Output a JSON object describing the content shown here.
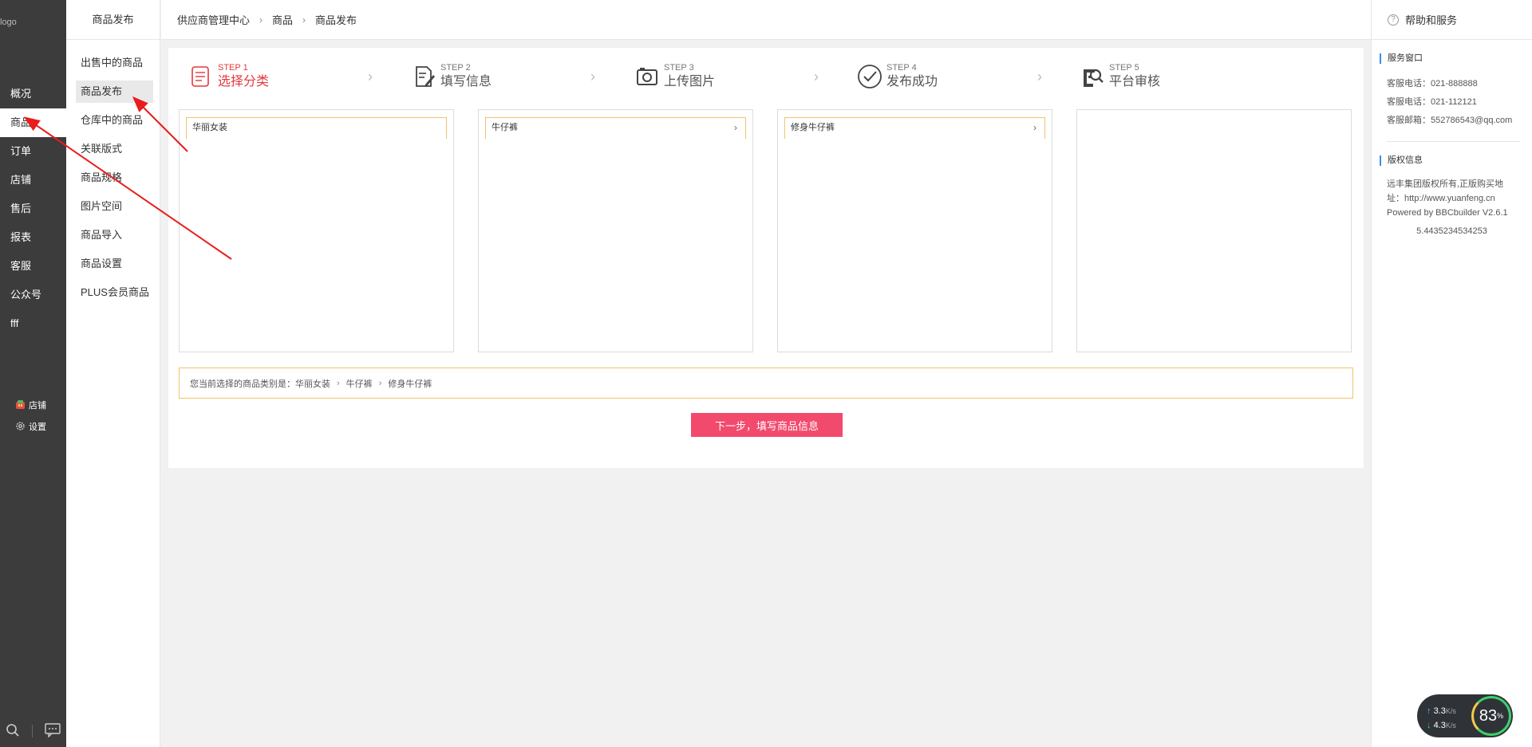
{
  "logo_alt": "logo",
  "nav": {
    "items": [
      {
        "label": "概况"
      },
      {
        "label": "商品",
        "active": true
      },
      {
        "label": "订单"
      },
      {
        "label": "店铺"
      },
      {
        "label": "售后"
      },
      {
        "label": "报表"
      },
      {
        "label": "客服"
      },
      {
        "label": "公众号"
      },
      {
        "label": "fff"
      }
    ],
    "tools": [
      {
        "label": "店铺",
        "icon": "shop-icon"
      },
      {
        "label": "设置",
        "icon": "gear-icon"
      }
    ],
    "bottom_icons": [
      "search-icon",
      "chat-icon"
    ]
  },
  "subnav": {
    "title": "商品发布",
    "items": [
      {
        "label": "出售中的商品"
      },
      {
        "label": "商品发布",
        "active": true
      },
      {
        "label": "仓库中的商品"
      },
      {
        "label": "关联版式"
      },
      {
        "label": "商品规格"
      },
      {
        "label": "图片空间"
      },
      {
        "label": "商品导入"
      },
      {
        "label": "商品设置"
      },
      {
        "label": "PLUS会员商品"
      }
    ]
  },
  "breadcrumb": [
    "供应商管理中心",
    "商品",
    "商品发布"
  ],
  "steps": [
    {
      "num": "STEP 1",
      "label": "选择分类",
      "icon": "list-icon",
      "active": true
    },
    {
      "num": "STEP 2",
      "label": "填写信息",
      "icon": "edit-icon"
    },
    {
      "num": "STEP 3",
      "label": "上传图片",
      "icon": "camera-icon"
    },
    {
      "num": "STEP 4",
      "label": "发布成功",
      "icon": "check-circle-icon"
    },
    {
      "num": "STEP 5",
      "label": "平台审核",
      "icon": "search-doc-icon"
    }
  ],
  "category_columns": [
    {
      "option": "华丽女装",
      "has_arrow": false
    },
    {
      "option": "牛仔裤",
      "has_arrow": true
    },
    {
      "option": "修身牛仔裤",
      "has_arrow": true
    },
    {
      "option": "",
      "has_arrow": false
    }
  ],
  "selected": {
    "prefix": "您当前选择的商品类别是：",
    "path": [
      "华丽女装",
      "牛仔裤",
      "修身牛仔裤"
    ]
  },
  "next_button": "下一步，填写商品信息",
  "help": {
    "title": "帮助和服务",
    "service_title": "服务窗口",
    "service_lines": [
      "客服电话：021-888888",
      "客服电话：021-112121",
      "客服邮箱：552786543@qq.com"
    ],
    "copyright_title": "版权信息",
    "copyright_text": "远丰集团版权所有,正版购买地址：http://www.yuanfeng.cn Powered by BBCbuilder V2.6.1",
    "version": "5.4435234534253"
  },
  "speed_widget": {
    "up": "3.3",
    "down": "4.3",
    "unit": "K/s",
    "percent": "83",
    "percent_sign": "%"
  },
  "colors": {
    "sidebar": "#3c3c3c",
    "accent": "#e4393c",
    "button": "#f24a6d",
    "highlight_border": "#f0c36d"
  }
}
